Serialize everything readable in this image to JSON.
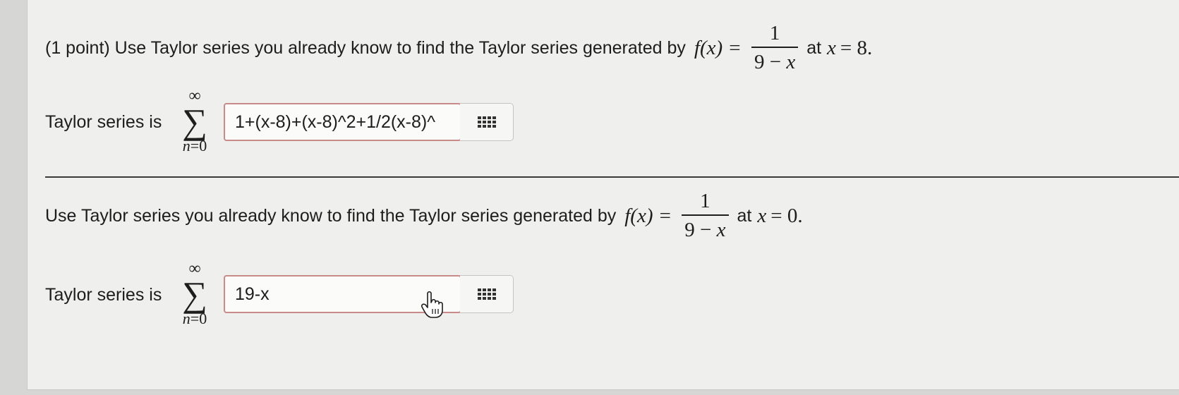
{
  "problem1": {
    "prefix": "(1 point) Use Taylor series you already know to find the Taylor series generated by",
    "fx": "f(x) =",
    "numerator": "1",
    "den_left": "9 −",
    "den_var": "x",
    "at_text": "at",
    "at_var": "x",
    "at_value": "= 8."
  },
  "answer1": {
    "label": "Taylor series is",
    "sum_top": "∞",
    "sum_symbol": "∑",
    "sum_var": "n",
    "sum_start": "=0",
    "value": "1+(x-8)+(x-8)^2+1/2(x-8)^"
  },
  "problem2": {
    "prefix": "Use Taylor series you already know to find the Taylor series generated by",
    "fx": "f(x) =",
    "numerator": "1",
    "den_left": "9 −",
    "den_var": "x",
    "at_text": "at",
    "at_var": "x",
    "at_value": "= 0."
  },
  "answer2": {
    "label": "Taylor series is",
    "sum_top": "∞",
    "sum_symbol": "∑",
    "sum_var": "n",
    "sum_start": "=0",
    "value": "19-x"
  },
  "icons": {
    "grid": "grid-icon",
    "cursor": "hand-pointer-icon"
  },
  "colors": {
    "answer_border": "#c98a8a",
    "background": "#efefed"
  }
}
